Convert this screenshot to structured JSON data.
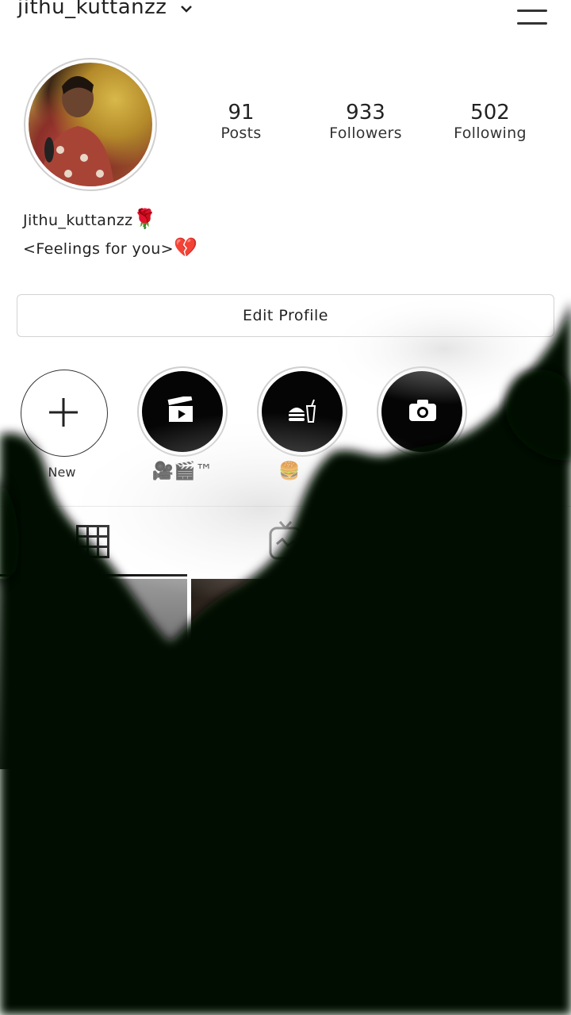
{
  "header": {
    "username": "jithu_kuttanzz",
    "dropdown_icon": "chevron-down-icon",
    "menu_icon": "hamburger-menu-icon"
  },
  "profile": {
    "stats": [
      {
        "value": "91",
        "label": "Posts"
      },
      {
        "value": "933",
        "label": "Followers"
      },
      {
        "value": "502",
        "label": "Following"
      }
    ],
    "bio_name": "Jithu_kuttanzz",
    "bio_name_emoji": "🌹",
    "bio_text": "<Feelings for you>",
    "bio_text_emoji": "💔",
    "edit_button_label": "Edit Profile"
  },
  "highlights": [
    {
      "label": "New",
      "icon": "plus-icon"
    },
    {
      "label": "🎥🎬™",
      "icon": "clapperboard-icon"
    },
    {
      "label": "🍔",
      "icon": "burger-drink-icon"
    },
    {
      "label": "",
      "icon": "camera-icon"
    }
  ],
  "tabs": [
    {
      "icon": "grid-icon",
      "active": true
    },
    {
      "icon": "igtv-icon",
      "active": false
    }
  ],
  "colors": {
    "overlay": "#030a06",
    "text": "#222222",
    "border": "#d3d3d3"
  }
}
